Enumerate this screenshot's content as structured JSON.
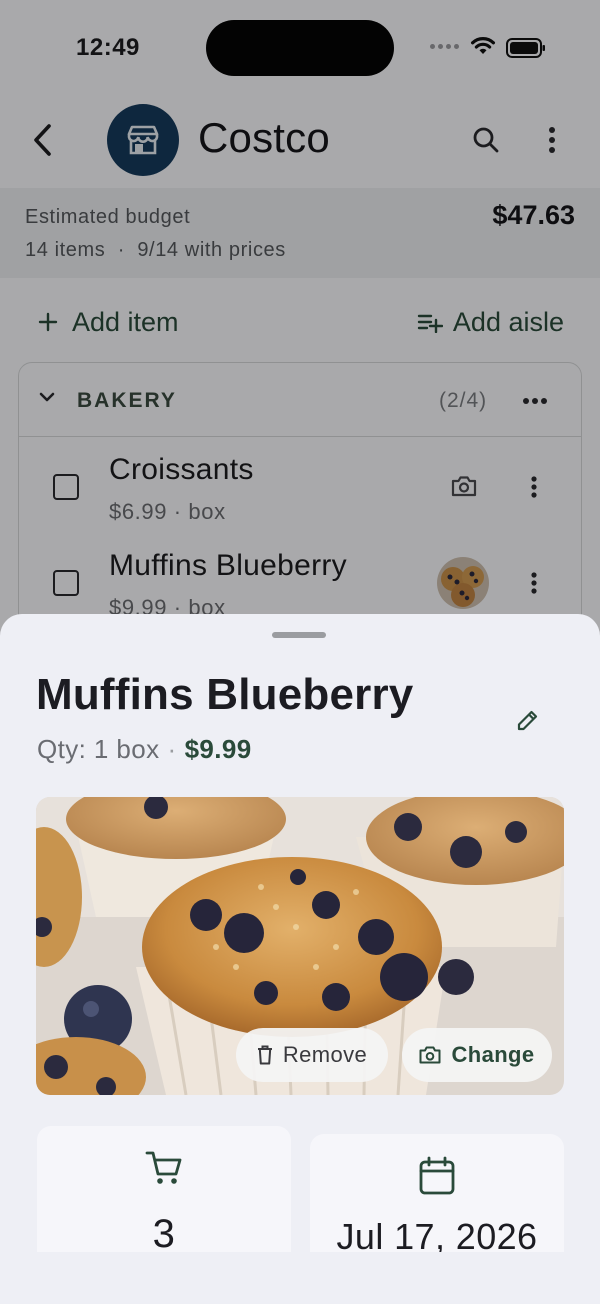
{
  "status_bar": {
    "time": "12:49"
  },
  "app_bar": {
    "store_name": "Costco",
    "back_icon": "chevron-left-icon",
    "store_icon": "storefront-icon",
    "search_icon": "search-icon",
    "more_icon": "more-vert-icon"
  },
  "budget": {
    "label": "Estimated budget",
    "items_count": "14 items",
    "separator": "·",
    "with_prices": "9/14 with prices",
    "amount": "$47.63"
  },
  "actions": {
    "add_item": "Add item",
    "add_aisle": "Add aisle"
  },
  "aisle": {
    "name": "BAKERY",
    "count": "(2/4)",
    "items": [
      {
        "name": "Croissants",
        "price": "$6.99 · box",
        "has_photo": false
      },
      {
        "name": "Muffins Blueberry",
        "price": "$9.99 · box",
        "has_photo": true
      }
    ]
  },
  "sheet": {
    "title": "Muffins Blueberry",
    "qty": "Qty: 1 box",
    "separator": "·",
    "price": "$9.99",
    "remove_label": "Remove",
    "change_label": "Change",
    "quantity_value": "3",
    "date_value": "Jul 17, 2026"
  },
  "colors": {
    "accent": "#2a4a3a",
    "store_avatar": "#163a5c",
    "sheet_bg": "#eeeff5"
  }
}
